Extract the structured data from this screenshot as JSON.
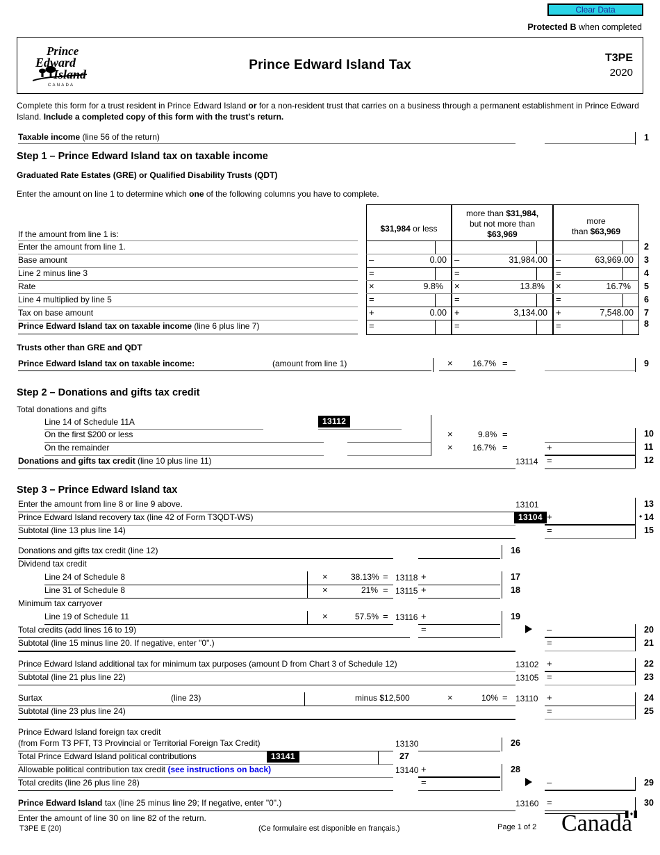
{
  "toolbar": {
    "clear_data_label": "Clear Data",
    "clear_data_color": "#2ad4e6"
  },
  "protected": {
    "bold": "Protected B",
    "rest": " when completed"
  },
  "header": {
    "logo_alt": "Prince Edward Island Canada",
    "logo_line1": "Prince",
    "logo_line2": "Edward",
    "logo_line3": "Island",
    "logo_sub": "C A N A D A",
    "title": "Prince Edward Island Tax",
    "form_code": "T3PE",
    "year": "2020"
  },
  "intro": {
    "p1_a": "Complete this form for a trust resident in Prince Edward Island ",
    "p1_b": "or",
    "p1_c": " for a non-resident trust that carries on a business through a permanent establishment in Prince Edward Island. ",
    "p1_d": "Include a completed copy of this form with the trust's return."
  },
  "taxable_income": {
    "label_bold": "Taxable income",
    "label_rest": " (line 56 of the return)",
    "line_no": "1"
  },
  "step1": {
    "heading": "Step 1 – Prince Edward Island tax on taxable income",
    "subheading": "Graduated Rate Estates (GRE) or Qualified Disability Trusts (QDT)",
    "instruction_a": "Enter the amount on line 1 to determine which ",
    "instruction_b": "one",
    "instruction_c": " of the following columns you have to complete.",
    "row_header": "If the amount from line 1 is:",
    "columns": [
      {
        "l1": "",
        "l2": "",
        "l3_bold": "$31,984",
        "l3_rest": " or less"
      },
      {
        "l1": "more than ",
        "l1b": "$31,984,",
        "l2": "but not more than",
        "l3_bold": "$63,969",
        "l3_rest": ""
      },
      {
        "l1": "",
        "l2": "more",
        "l3_pre": "than ",
        "l3_bold": "$63,969",
        "l3_rest": ""
      }
    ],
    "rows": [
      {
        "line_no": "2",
        "label": "Enter the amount from line 1.",
        "ops": [
          "",
          "",
          ""
        ],
        "values": [
          "",
          "",
          ""
        ]
      },
      {
        "line_no": "3",
        "label": "Base amount",
        "ops": [
          "–",
          "–",
          "–"
        ],
        "values": [
          "0.00",
          "31,984.00",
          "63,969.00"
        ]
      },
      {
        "line_no": "4",
        "label": "Line 2 minus line 3",
        "ops": [
          "=",
          "=",
          "="
        ],
        "values": [
          "",
          "",
          ""
        ]
      },
      {
        "line_no": "5",
        "label": "Rate",
        "ops": [
          "×",
          "×",
          "×"
        ],
        "values": [
          "9.8%",
          "13.8%",
          "16.7%"
        ]
      },
      {
        "line_no": "6",
        "label": "Line 4 multiplied by line 5",
        "ops": [
          "=",
          "=",
          "="
        ],
        "values": [
          "",
          "",
          ""
        ]
      },
      {
        "line_no": "7",
        "label": "Tax on base amount",
        "ops": [
          "+",
          "+",
          "+"
        ],
        "values": [
          "0.00",
          "3,134.00",
          "7,548.00"
        ]
      },
      {
        "line_no": "8",
        "label_bold": "Prince Edward Island tax on taxable income",
        "label_rest": " (line 6 plus line 7)",
        "ops": [
          "=",
          "=",
          "="
        ],
        "values": [
          "",
          "",
          ""
        ]
      }
    ],
    "trusts_other_heading": "Trusts other than GRE and QDT",
    "line9": {
      "label": "Prince Edward Island tax on taxable income:",
      "note": "(amount from line 1)",
      "op_mult": "×",
      "rate": "16.7%",
      "op_eq": "=",
      "line_no": "9"
    }
  },
  "step2": {
    "heading": "Step 2 – Donations and gifts tax credit",
    "total_label": "Total donations and gifts",
    "sched_line": "Line 14 of Schedule 11A",
    "sched_code": "13112",
    "line10": {
      "label": "On the first $200 or less",
      "op_mult": "×",
      "rate": "9.8%",
      "op_eq": "=",
      "line_no": "10"
    },
    "line11": {
      "label": "On the remainder",
      "op_mult": "×",
      "rate": "16.7%",
      "op_eq": "=",
      "op_add": "+",
      "line_no": "11"
    },
    "line12": {
      "label_bold": "Donations and gifts tax credit",
      "label_rest": " (line 10 plus line 11)",
      "code": "13114",
      "op": "=",
      "line_no": "12"
    }
  },
  "step3": {
    "heading": "Step 3 – Prince Edward Island tax",
    "line13": {
      "label": "Enter the amount from line 8 or line 9 above.",
      "code": "13101",
      "line_no": "13"
    },
    "line14": {
      "label": "Prince Edward Island recovery tax (line 42 of Form T3QDT-WS)",
      "code_box": "13104",
      "op": "+",
      "bullet": "•",
      "line_no": "14"
    },
    "line15": {
      "label": "Subtotal (line 13 plus line 14)",
      "op": "=",
      "line_no": "15"
    },
    "line16": {
      "label": "Donations and gifts tax credit (line 12)",
      "line_no": "16"
    },
    "dividend_heading": "Dividend tax credit",
    "line17": {
      "label": "Line 24 of Schedule 8",
      "op_mult": "×",
      "rate": "38.13%",
      "op_eq": "=",
      "code": "13118",
      "op_add": "+",
      "line_no": "17"
    },
    "line18": {
      "label": "Line 31 of Schedule 8",
      "op_mult": "×",
      "rate": "21%",
      "op_eq": "=",
      "code": "13115",
      "op_add": "+",
      "line_no": "18"
    },
    "mintax_heading": "Minimum tax carryover",
    "line19": {
      "label": "Line 19 of Schedule 11",
      "op_mult": "×",
      "rate": "57.5%",
      "op_eq": "=",
      "code": "13116",
      "op_add": "+",
      "line_no": "19"
    },
    "line20": {
      "label": "Total credits (add lines 16 to 19)",
      "op_eq": "=",
      "op_minus": "–",
      "line_no": "20"
    },
    "line21": {
      "label": "Subtotal (line 15 minus line 20. If negative, enter \"0\".)",
      "op": "=",
      "line_no": "21"
    },
    "line22": {
      "label": "Prince Edward Island additional tax for minimum tax purposes (amount D from Chart 3 of Schedule 12)",
      "code": "13102",
      "op": "+",
      "line_no": "22"
    },
    "line23": {
      "label": "Subtotal (line 21 plus line 22)",
      "code": "13105",
      "op": "=",
      "line_no": "23"
    },
    "line24": {
      "label": "Surtax",
      "note": "(line 23)",
      "minus_text": "minus $12,500",
      "op_mult": "×",
      "rate": "10%",
      "op_eq": "=",
      "code": "13110",
      "op_add": "+",
      "line_no": "24"
    },
    "line25": {
      "label": "Subtotal (line 23 plus line 24)",
      "op": "=",
      "line_no": "25"
    },
    "line26": {
      "label_l1": "Prince Edward Island foreign tax credit",
      "label_l2": "(from Form T3 PFT, T3 Provincial or Territorial Foreign Tax Credit)",
      "code": "13130",
      "line_no": "26"
    },
    "line27": {
      "label": "Total Prince Edward Island political contributions",
      "code_box": "13141",
      "line_no": "27"
    },
    "line28": {
      "label": "Allowable political contribution tax credit ",
      "link": "(see instructions on back)",
      "code": "13140",
      "op": "+",
      "line_no": "28"
    },
    "line29": {
      "label": "Total credits (line 26 plus line 28)",
      "op_eq": "=",
      "op_minus": "–",
      "line_no": "29"
    },
    "line30": {
      "label_bold": "Prince Edward Island",
      "label_rest": " tax (line 25 minus line 29; If negative, enter \"0\".)",
      "code": "13160",
      "op": "=",
      "line_no": "30"
    },
    "closing": "Enter the amount of line 30 on line 82 of the return."
  },
  "footer": {
    "form_id": "T3PE E (20)",
    "french_note": "(Ce formulaire est disponible en français.)",
    "page": "Page 1 of 2",
    "wordmark": "Canada"
  }
}
